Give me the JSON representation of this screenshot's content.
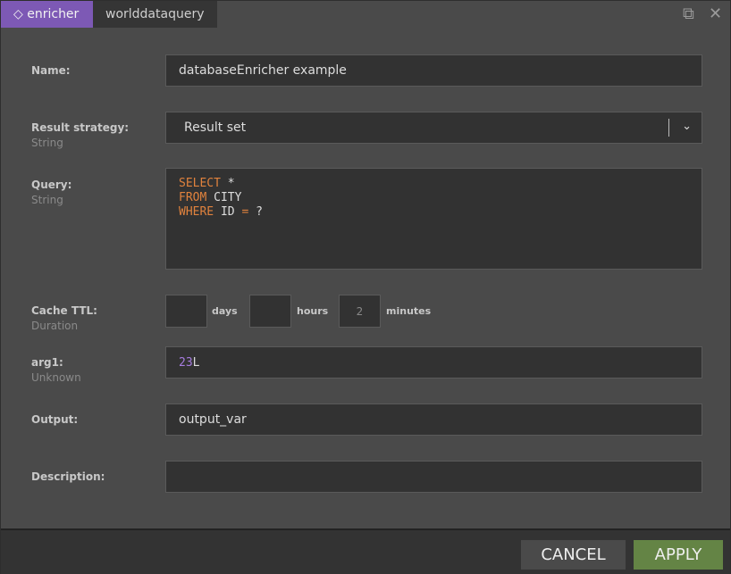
{
  "tabs": [
    {
      "label": "enricher",
      "icon": "gem-icon",
      "active": true
    },
    {
      "label": "worlddataquery"
    }
  ],
  "colors": {
    "accent": "#7d59b5",
    "apply": "#648445",
    "keyword": "#e0823d",
    "number": "#a77de0"
  },
  "form": {
    "name": {
      "label": "Name:",
      "value": "databaseEnricher example"
    },
    "strategy": {
      "label": "Result strategy:",
      "type": "String",
      "value": "Result set"
    },
    "query": {
      "label": "Query:",
      "type": "String",
      "lines": [
        [
          "SELECT",
          " *"
        ],
        [
          "FROM",
          " CITY"
        ],
        [
          "WHERE",
          " ID ",
          "=",
          " ?"
        ]
      ]
    },
    "cache": {
      "label": "Cache TTL:",
      "type": "Duration",
      "days": "",
      "days_label": "days",
      "hours": "",
      "hours_label": "hours",
      "minutes": "2",
      "minutes_label": "minutes"
    },
    "arg1": {
      "label": "arg1:",
      "type": "Unknown",
      "num": "23",
      "suffix": "L"
    },
    "output": {
      "label": "Output:",
      "value": "output_var"
    },
    "description": {
      "label": "Description:",
      "value": ""
    }
  },
  "footer": {
    "cancel": "CANCEL",
    "apply": "APPLY"
  }
}
